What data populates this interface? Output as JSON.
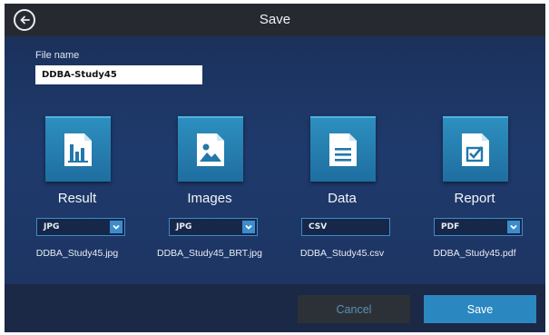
{
  "window": {
    "title": "Save"
  },
  "file_name": {
    "label": "File name",
    "value": "DDBA-Study45"
  },
  "outputs": [
    {
      "label": "Result",
      "format": "JPG",
      "filename": "DDBA_Study45.jpg",
      "icon": "bar-chart-document-icon",
      "has_dropdown": true
    },
    {
      "label": "Images",
      "format": "JPG",
      "filename": "DDBA_Study45_BRT.jpg",
      "icon": "image-document-icon",
      "has_dropdown": true
    },
    {
      "label": "Data",
      "format": "CSV",
      "filename": "DDBA_Study45.csv",
      "icon": "text-document-icon",
      "has_dropdown": false
    },
    {
      "label": "Report",
      "format": "PDF",
      "filename": "DDBA_Study45.pdf",
      "icon": "checklist-document-icon",
      "has_dropdown": true
    }
  ],
  "footer": {
    "cancel_label": "Cancel",
    "save_label": "Save"
  },
  "colors": {
    "background": "#1e3a6c",
    "titlebar": "#262a30",
    "tile": "#2a86b8",
    "accent": "#3d8ccc",
    "save_button": "#2b87bf",
    "cancel_button": "#2c3138"
  }
}
